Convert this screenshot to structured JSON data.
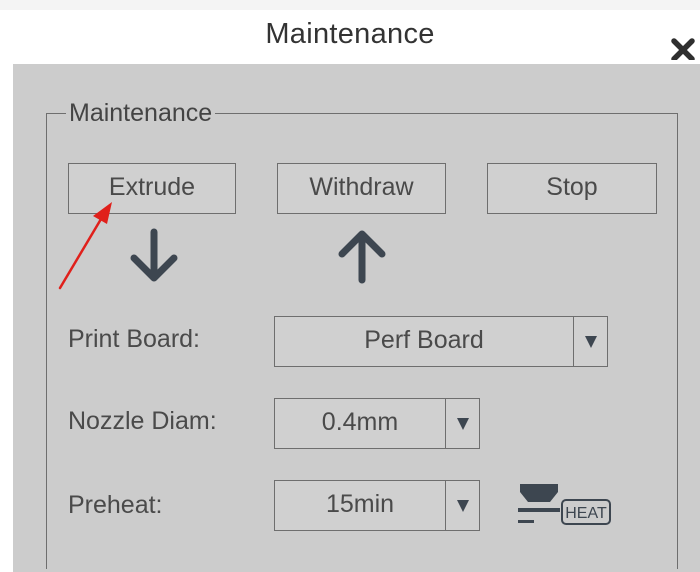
{
  "dialog": {
    "title": "Maintenance",
    "close_icon": "close-icon"
  },
  "group": {
    "legend": "Maintenance"
  },
  "buttons": {
    "extrude": "Extrude",
    "withdraw": "Withdraw",
    "stop": "Stop"
  },
  "icons": {
    "extrude_direction": "arrow-down-icon",
    "withdraw_direction": "arrow-up-icon",
    "preheat": "heat-icon",
    "heat_badge_text": "HEAT",
    "dropdown": "caret-down-icon"
  },
  "fields": {
    "print_board": {
      "label": "Print Board:",
      "value": "Perf Board"
    },
    "nozzle_diam": {
      "label": "Nozzle Diam:",
      "value": "0.4mm"
    },
    "preheat": {
      "label": "Preheat:",
      "value": "15min"
    }
  },
  "colors": {
    "panel_background": "#cccccc",
    "border": "#6e6e6e",
    "icon_dark": "#3d4650",
    "annotation_arrow": "#e0201b"
  }
}
